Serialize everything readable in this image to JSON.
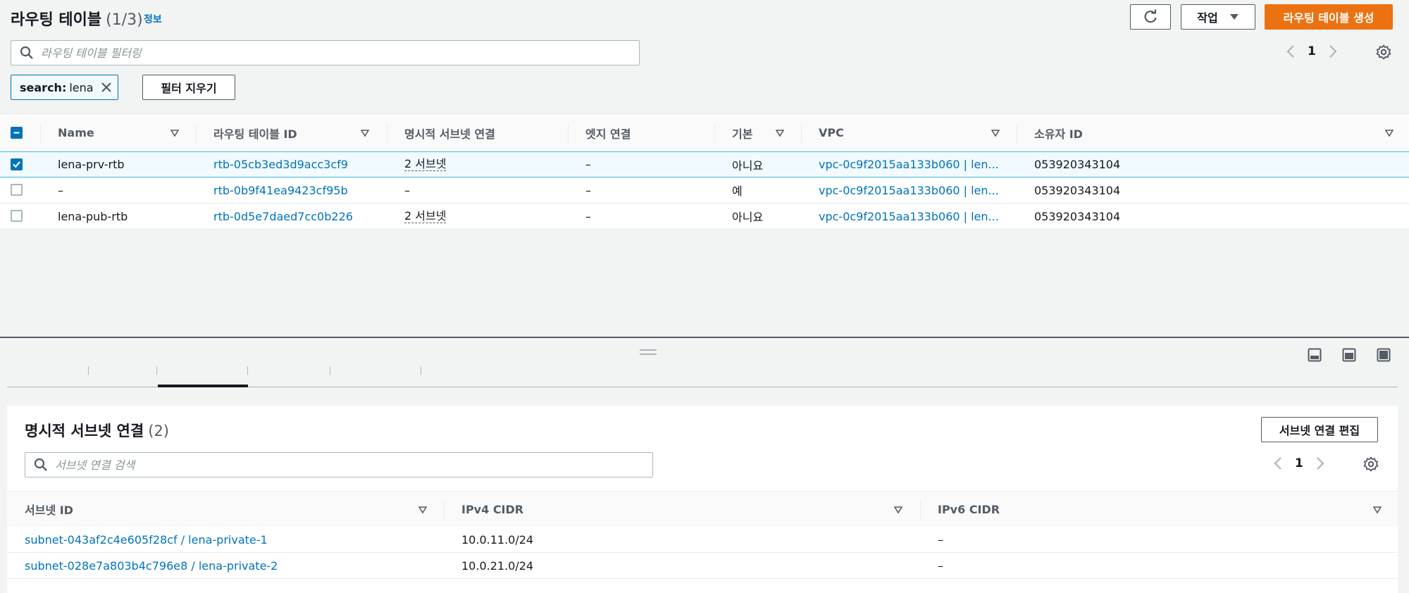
{
  "header": {
    "title": "라우팅 테이블",
    "count": "(1/3)",
    "info": "정보",
    "actions_label": "작업",
    "create_label": "라우팅 테이블 생성"
  },
  "filter": {
    "placeholder": "라우팅 테이블 필터링",
    "token_key": "search:",
    "token_value": "lena",
    "clear_label": "필터 지우기"
  },
  "pagination": {
    "page": "1"
  },
  "table": {
    "columns": [
      "Name",
      "라우팅 테이블 ID",
      "명시적 서브넷 연결",
      "엣지 연결",
      "기본",
      "VPC",
      "소유자 ID"
    ],
    "rows": [
      {
        "name": "lena-prv-rtb",
        "id": "rtb-05cb3ed3d9acc3cf9",
        "subnets": "2 서브넷",
        "edge": "–",
        "main": "아니요",
        "vpc": "vpc-0c9f2015aa133b060 | len...",
        "owner": "053920343104",
        "selected": true
      },
      {
        "name": "–",
        "id": "rtb-0b9f41ea9423cf95b",
        "subnets": "–",
        "edge": "–",
        "main": "예",
        "vpc": "vpc-0c9f2015aa133b060 | len...",
        "owner": "053920343104",
        "selected": false
      },
      {
        "name": "lena-pub-rtb",
        "id": "rtb-0d5e7daed7cc0b226",
        "subnets": "2 서브넷",
        "edge": "–",
        "main": "아니요",
        "vpc": "vpc-0c9f2015aa133b060 | len...",
        "owner": "053920343104",
        "selected": false
      }
    ]
  },
  "detail": {
    "title": "명시적 서브넷 연결",
    "count": "(2)",
    "edit_label": "서브넷 연결 편집",
    "search_placeholder": "서브넷 연결 검색",
    "page": "1",
    "columns": [
      "서브넷 ID",
      "IPv4 CIDR",
      "IPv6 CIDR"
    ],
    "rows": [
      {
        "subnet": "subnet-043af2c4e605f28cf / lena-private-1",
        "ipv4": "10.0.11.0/24",
        "ipv6": "–"
      },
      {
        "subnet": "subnet-028e7a803b4c796e8 / lena-private-2",
        "ipv4": "10.0.21.0/24",
        "ipv6": "–"
      }
    ]
  },
  "colors": {
    "primary": "#ec7211",
    "link": "#0073bb",
    "selected_bg": "#f1faff"
  }
}
